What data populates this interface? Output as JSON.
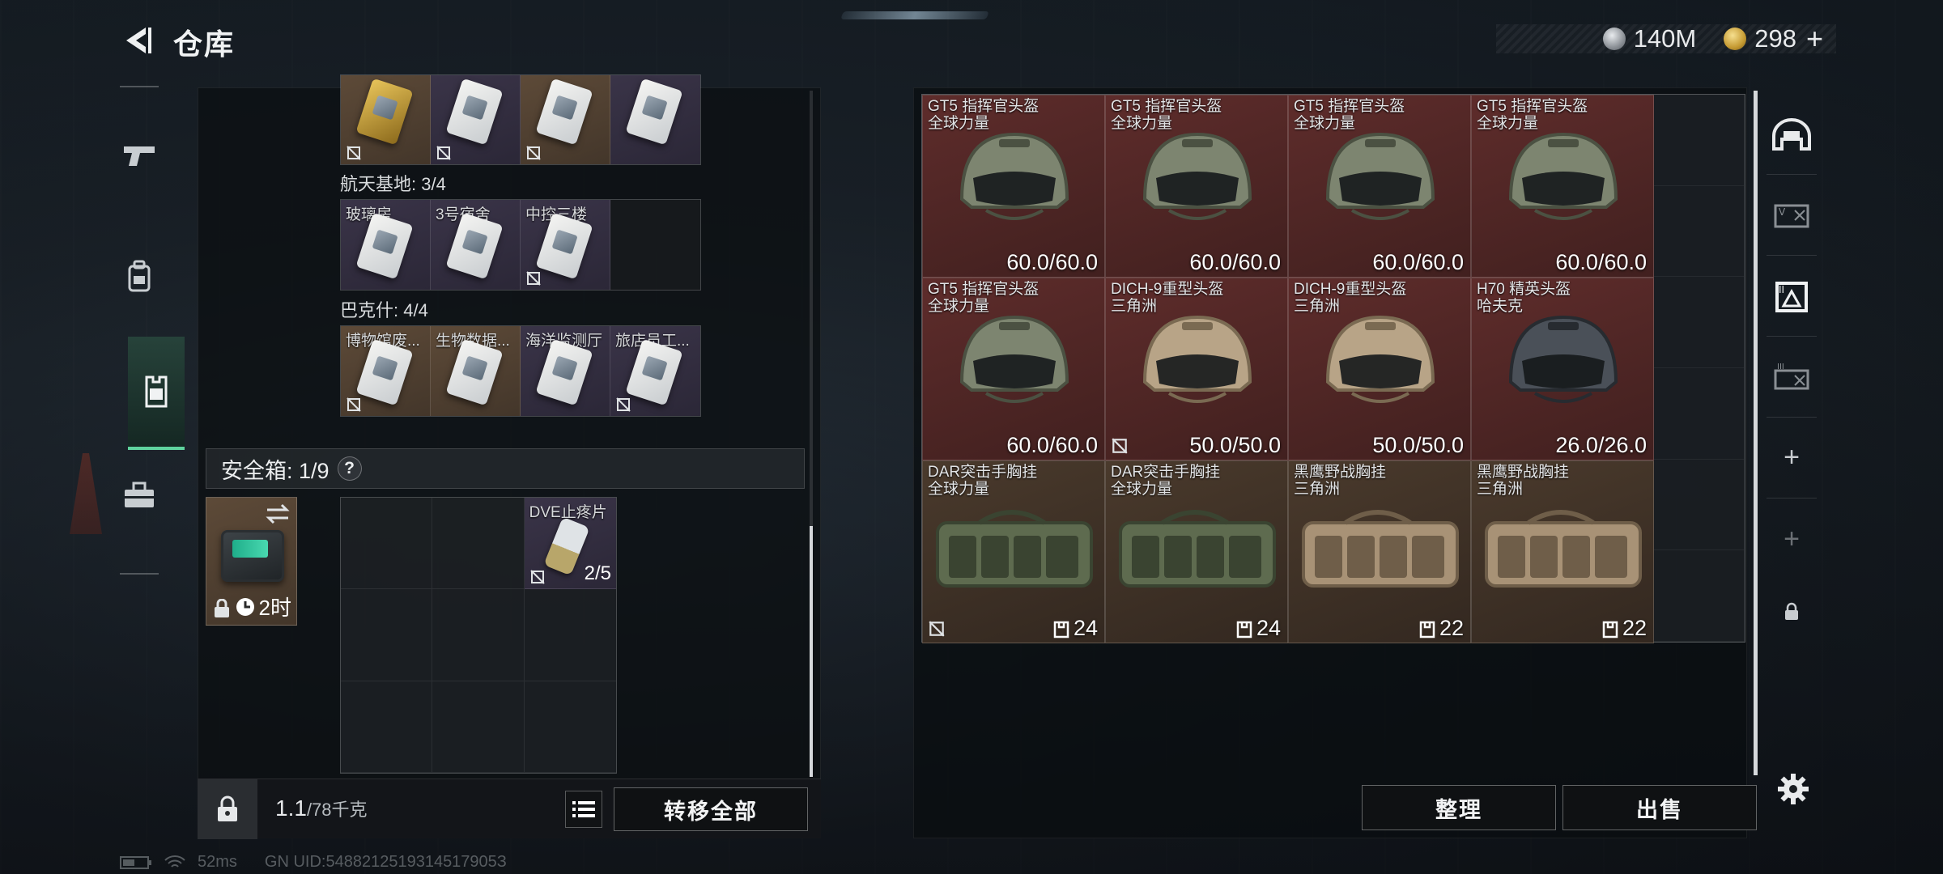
{
  "header": {
    "title": "仓库",
    "currency_silver": "140M",
    "currency_gold": "298",
    "add_label": "+"
  },
  "left_nav": {
    "items": [
      "pistol-icon",
      "backpack-icon",
      "vest-icon",
      "toolbox-icon"
    ],
    "active": "vest-icon"
  },
  "keycards": {
    "top_row": {
      "items": [
        {
          "name": "",
          "color": "brown",
          "card": "gold"
        },
        {
          "name": "",
          "color": "purple",
          "card": "white"
        },
        {
          "name": "",
          "color": "brown",
          "card": "white"
        },
        {
          "name": "",
          "color": "purple",
          "card": "white"
        }
      ]
    },
    "group1": {
      "label": "航天基地: 3/4",
      "items": [
        {
          "name": "玻璃房",
          "color": "purple"
        },
        {
          "name": "3号宿舍",
          "color": "purple"
        },
        {
          "name": "中控三楼",
          "color": "purple"
        },
        {
          "name": "",
          "color": "empty"
        }
      ]
    },
    "group2": {
      "label": "巴克什: 4/4",
      "items": [
        {
          "name": "博物馆废...",
          "color": "brown"
        },
        {
          "name": "生物数据...",
          "color": "brown"
        },
        {
          "name": "海洋监测厅",
          "color": "purple"
        },
        {
          "name": "旅店员工...",
          "color": "purple"
        }
      ]
    }
  },
  "safe_box": {
    "label": "安全箱: 1/9",
    "help": "?",
    "timer": "2时",
    "slot_item": {
      "name": "DVE止疼片",
      "qty": "2/5"
    }
  },
  "bottom": {
    "weight_current": "1.1",
    "weight_max": "/78千克",
    "transfer_all": "转移全部"
  },
  "status": {
    "ping": "52ms",
    "uid": "GN UID:5488212519314517905З"
  },
  "stash": {
    "items": [
      {
        "name1": "GT5 指挥官头盔",
        "name2": "全球力量",
        "value": "60.0/60.0",
        "kind": "helmet-green",
        "color": "red",
        "bind": false
      },
      {
        "name1": "GT5 指挥官头盔",
        "name2": "全球力量",
        "value": "60.0/60.0",
        "kind": "helmet-green",
        "color": "red",
        "bind": false
      },
      {
        "name1": "GT5 指挥官头盔",
        "name2": "全球力量",
        "value": "60.0/60.0",
        "kind": "helmet-green",
        "color": "red",
        "bind": false
      },
      {
        "name1": "GT5 指挥官头盔",
        "name2": "全球力量",
        "value": "60.0/60.0",
        "kind": "helmet-green",
        "color": "red",
        "bind": false
      },
      {
        "name1": "GT5 指挥官头盔",
        "name2": "全球力量",
        "value": "60.0/60.0",
        "kind": "helmet-green",
        "color": "red",
        "bind": false
      },
      {
        "name1": "DICH-9重型头盔",
        "name2": "三角洲",
        "value": "50.0/50.0",
        "kind": "helmet-tan",
        "color": "red",
        "bind": true
      },
      {
        "name1": "DICH-9重型头盔",
        "name2": "三角洲",
        "value": "50.0/50.0",
        "kind": "helmet-tan",
        "color": "red",
        "bind": false
      },
      {
        "name1": "H70 精英头盔",
        "name2": "哈夫克",
        "value": "26.0/26.0",
        "kind": "helmet-black",
        "color": "red",
        "bind": false
      },
      {
        "name1": "DAR突击手胸挂",
        "name2": "全球力量",
        "value": "24",
        "kind": "vest-green",
        "color": "brown",
        "bind": true
      },
      {
        "name1": "DAR突击手胸挂",
        "name2": "全球力量",
        "value": "24",
        "kind": "vest-green",
        "color": "brown",
        "bind": false
      },
      {
        "name1": "黑鹰野战胸挂",
        "name2": "三角洲",
        "value": "22",
        "kind": "vest-tan",
        "color": "brown",
        "bind": false
      },
      {
        "name1": "黑鹰野战胸挂",
        "name2": "三角洲",
        "value": "22",
        "kind": "vest-tan",
        "color": "brown",
        "bind": false
      }
    ]
  },
  "right_nav": {
    "items": [
      "helmet-slot-icon",
      "armor-slot-icon",
      "bag-slot-icon",
      "vest-slot-icon"
    ],
    "plus": "+"
  },
  "actions": {
    "sort": "整理",
    "sell": "出售"
  }
}
